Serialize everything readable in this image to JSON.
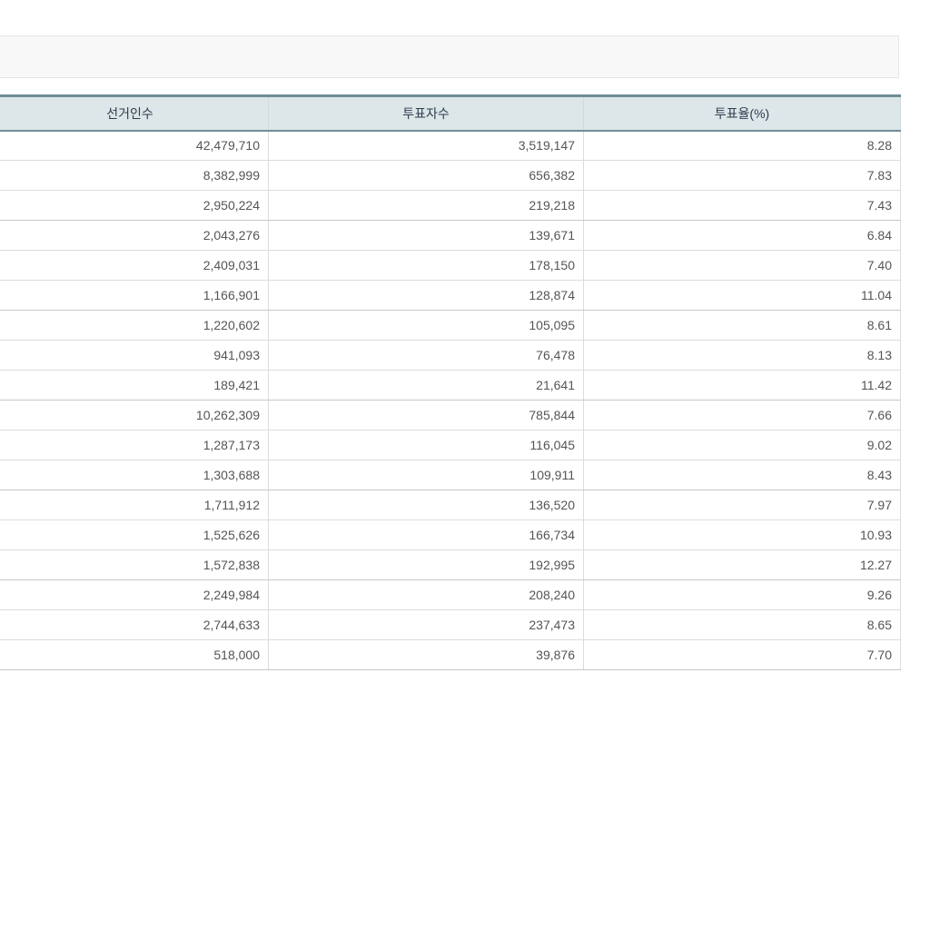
{
  "table": {
    "headers": [
      "선거인수",
      "투표자수",
      "투표율(%)"
    ],
    "rows": [
      [
        "42,479,710",
        "3,519,147",
        "8.28"
      ],
      [
        "8,382,999",
        "656,382",
        "7.83"
      ],
      [
        "2,950,224",
        "219,218",
        "7.43"
      ],
      [
        "2,043,276",
        "139,671",
        "6.84"
      ],
      [
        "2,409,031",
        "178,150",
        "7.40"
      ],
      [
        "1,166,901",
        "128,874",
        "11.04"
      ],
      [
        "1,220,602",
        "105,095",
        "8.61"
      ],
      [
        "941,093",
        "76,478",
        "8.13"
      ],
      [
        "189,421",
        "21,641",
        "11.42"
      ],
      [
        "10,262,309",
        "785,844",
        "7.66"
      ],
      [
        "1,287,173",
        "116,045",
        "9.02"
      ],
      [
        "1,303,688",
        "109,911",
        "8.43"
      ],
      [
        "1,711,912",
        "136,520",
        "7.97"
      ],
      [
        "1,525,626",
        "166,734",
        "10.93"
      ],
      [
        "1,572,838",
        "192,995",
        "12.27"
      ],
      [
        "2,249,984",
        "208,240",
        "9.26"
      ],
      [
        "2,744,633",
        "237,473",
        "8.65"
      ],
      [
        "518,000",
        "39,876",
        "7.70"
      ]
    ]
  }
}
